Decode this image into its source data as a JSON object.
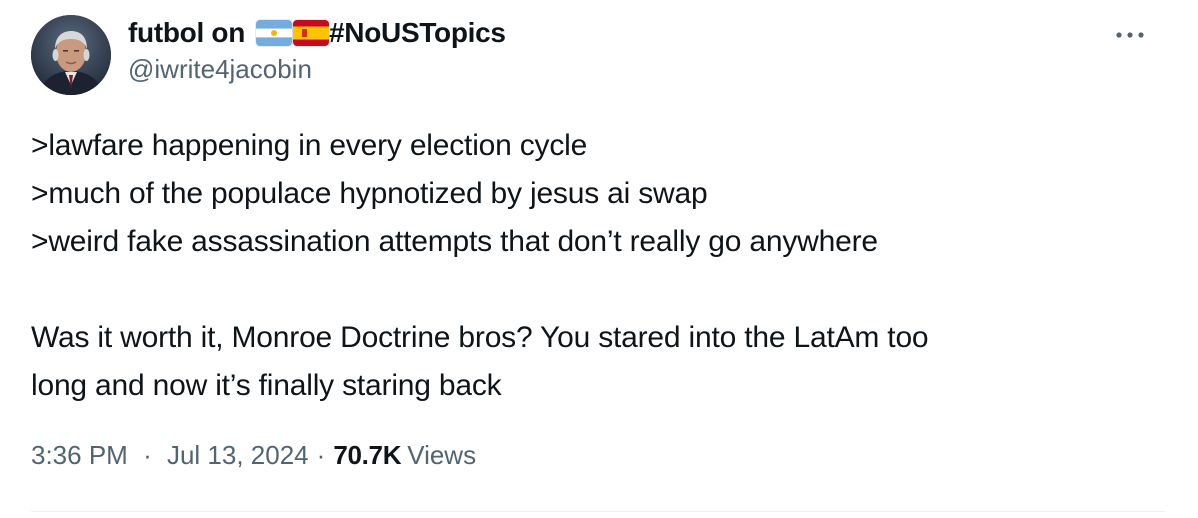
{
  "tweet": {
    "author": {
      "name_prefix": "futbol on",
      "name_suffix": "#NoUSTopics",
      "flags": [
        "argentina-flag-icon",
        "spain-flag-icon"
      ],
      "handle": "@iwrite4jacobin"
    },
    "lines": [
      ">lawfare happening in every election cycle",
      ">much of the populace hypnotized by jesus ai swap",
      ">weird fake assassination attempts that don’t really go anywhere",
      "Was it worth it, Monroe Doctrine bros? You stared into the LatAm too",
      "long and now it’s finally staring back"
    ],
    "meta": {
      "time": "3:36 PM",
      "separator": "·",
      "date": "Jul 13, 2024",
      "views_count": "70.7K",
      "views_label": "Views"
    },
    "more_icon": "more-horizontal-icon"
  },
  "colors": {
    "text_primary": "#0f1419",
    "text_secondary": "#536471",
    "divider": "#eff3f4"
  }
}
